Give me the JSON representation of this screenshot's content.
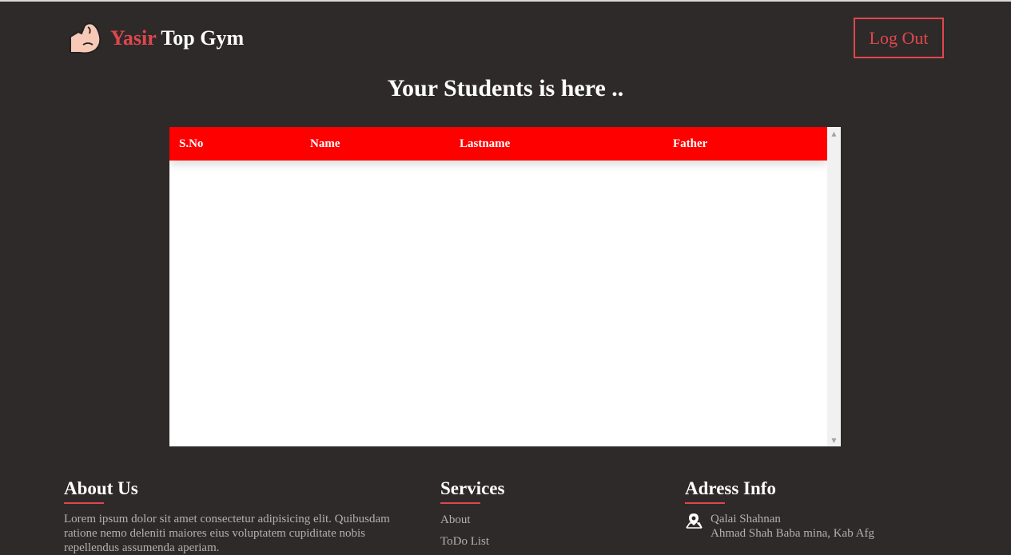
{
  "header": {
    "logo_icon": "flexed-bicep-icon",
    "brand_first": "Yasir",
    "brand_rest": " Top Gym",
    "logout_label": "Log Out"
  },
  "page_title": "Your Students is here ..",
  "table": {
    "columns": [
      "S.No",
      "Name",
      "Lastname",
      "Father"
    ],
    "rows": []
  },
  "footer": {
    "about": {
      "heading": "About Us",
      "text": "Lorem ipsum dolor sit amet consectetur adipisicing elit. Quibusdam ratione nemo deleniti maiores eius voluptatem cupiditate nobis repellendus assumenda aperiam."
    },
    "services": {
      "heading": "Services",
      "links": [
        "About",
        "ToDo List"
      ]
    },
    "address": {
      "heading": "Adress Info",
      "icon": "map-pin-icon",
      "line1": "Qalai Shahnan",
      "line2": "Ahmad Shah Baba mina, Kab Afg"
    }
  },
  "colors": {
    "background": "#2e2a2a",
    "accent": "#e0474c",
    "table_header": "#ff0000"
  }
}
